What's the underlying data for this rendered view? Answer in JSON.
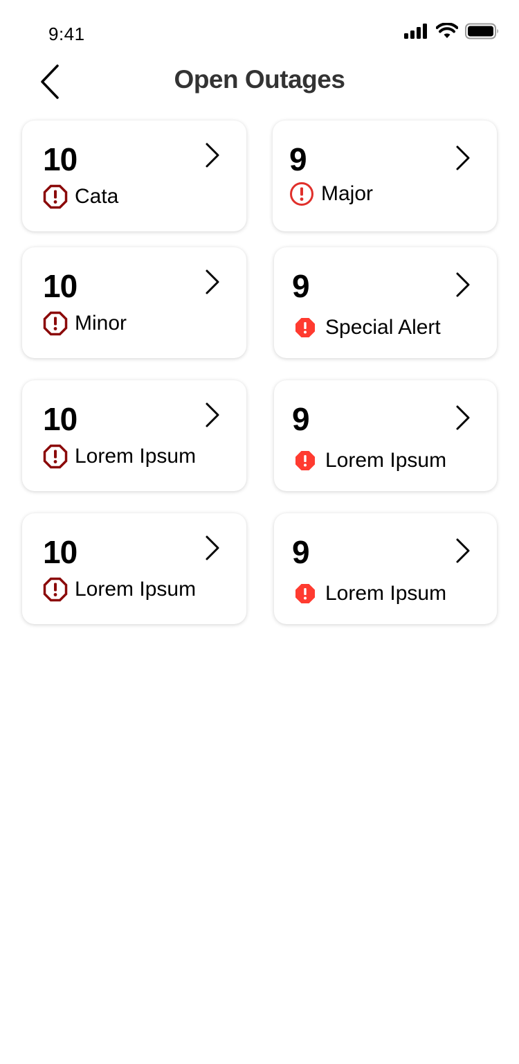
{
  "status_bar": {
    "time": "9:41",
    "icons": [
      "cellular-signal-icon",
      "wifi-icon",
      "battery-icon"
    ]
  },
  "header": {
    "title": "Open Outages",
    "back_icon": "chevron-left-icon"
  },
  "colors": {
    "dark_red": "#8B0A0A",
    "bright_red": "#E0302B",
    "alert_red": "#FF3B30",
    "title": "#333333"
  },
  "cards": [
    {
      "count": "10",
      "label": "Cata",
      "icon": "octagon-alert-outline-dark-red-icon"
    },
    {
      "count": "9",
      "label": "Major",
      "icon": "circle-alert-outline-red-icon"
    },
    {
      "count": "10",
      "label": "Minor",
      "icon": "octagon-alert-outline-dark-red-icon"
    },
    {
      "count": "9",
      "label": "Special Alert",
      "icon": "octagon-alert-filled-red-icon"
    },
    {
      "count": "10",
      "label": "Lorem Ipsum",
      "icon": "octagon-alert-outline-dark-red-icon"
    },
    {
      "count": "9",
      "label": "Lorem Ipsum",
      "icon": "octagon-alert-filled-red-icon"
    },
    {
      "count": "10",
      "label": "Lorem Ipsum",
      "icon": "octagon-alert-outline-dark-red-icon"
    },
    {
      "count": "9",
      "label": "Lorem Ipsum",
      "icon": "octagon-alert-filled-red-icon"
    }
  ]
}
